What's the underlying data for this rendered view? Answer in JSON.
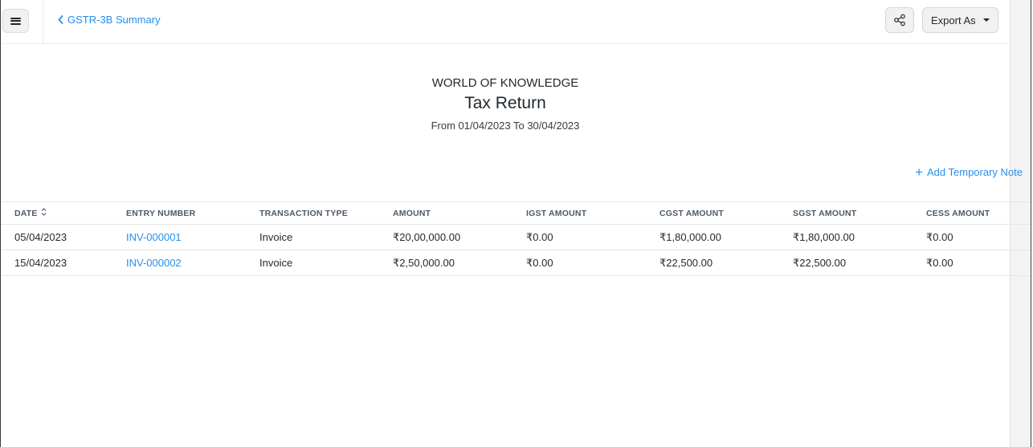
{
  "header": {
    "back_label": "GSTR-3B Summary",
    "export_label": "Export As"
  },
  "report": {
    "company": "WORLD OF KNOWLEDGE",
    "title": "Tax Return",
    "period": "From 01/04/2023 To 30/04/2023",
    "add_note_label": "Add Temporary Note"
  },
  "table": {
    "columns": [
      "DATE",
      "ENTRY NUMBER",
      "TRANSACTION TYPE",
      "AMOUNT",
      "IGST AMOUNT",
      "CGST AMOUNT",
      "SGST AMOUNT",
      "CESS AMOUNT"
    ],
    "rows": [
      [
        "05/04/2023",
        "INV-000001",
        "Invoice",
        "₹20,00,000.00",
        "₹0.00",
        "₹1,80,000.00",
        "₹1,80,000.00",
        "₹0.00"
      ],
      [
        "15/04/2023",
        "INV-000002",
        "Invoice",
        "₹2,50,000.00",
        "₹0.00",
        "₹22,500.00",
        "₹22,500.00",
        "₹0.00"
      ]
    ]
  },
  "colors": {
    "accent": "#2490ef",
    "text": "#1f272e",
    "border": "#e6e6e6"
  }
}
